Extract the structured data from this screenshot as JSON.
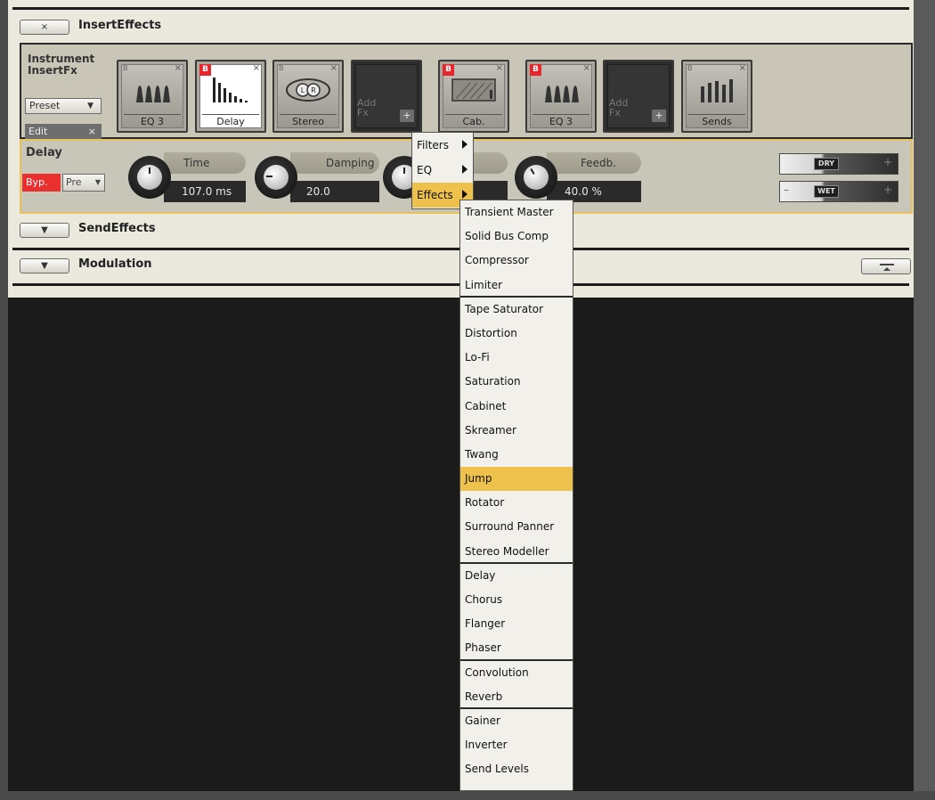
{
  "insert_effects": {
    "close_label": "×",
    "title": "InsertEffects",
    "fx_label_1": "Instrument",
    "fx_label_2": "InsertFx",
    "preset_label": "Preset",
    "edit_label": "Edit",
    "slots": [
      {
        "name": "EQ 3",
        "bypass_badge": ""
      },
      {
        "name": "Delay",
        "bypass_badge": "B"
      },
      {
        "name": "Stereo",
        "bypass_badge": ""
      },
      {
        "name": "",
        "add_line1": "Add",
        "add_line2": "Fx",
        "plus": "+"
      },
      {
        "name": "Cab.",
        "bypass_badge": "B"
      },
      {
        "name": "EQ 3",
        "bypass_badge": "B"
      },
      {
        "name": "",
        "add_line1": "Add",
        "add_line2": "Fx",
        "plus": "+"
      },
      {
        "name": "Sends",
        "bypass_badge": ""
      }
    ]
  },
  "delay_panel": {
    "title": "Delay",
    "bypass_label": "Byp.",
    "pre_label": "Pre",
    "params": [
      {
        "label": "Time",
        "value": "107.0  ms"
      },
      {
        "label": "Damping",
        "value": "20.0"
      },
      {
        "label": "",
        "value": ""
      },
      {
        "label": "Feedb.",
        "value": "40.0  %"
      }
    ],
    "dry_label": "DRY",
    "wet_label": "WET",
    "minus": "–",
    "plus": "+"
  },
  "send_effects": {
    "title": "SendEffects",
    "toggle": "▼"
  },
  "modulation": {
    "title": "Modulation",
    "toggle": "▼"
  },
  "context_menu": {
    "items": [
      "Filters",
      "EQ",
      "Effects"
    ],
    "highlighted": "Effects"
  },
  "effects_submenu": {
    "items": [
      "Transient Master",
      "Solid Bus Comp",
      "Compressor",
      "Limiter",
      "Tape Saturator",
      "Distortion",
      "Lo-Fi",
      "Saturation",
      "Cabinet",
      "Skreamer",
      "Twang",
      "Jump",
      "Rotator",
      "Surround Panner",
      "Stereo Modeller",
      "Delay",
      "Chorus",
      "Flanger",
      "Phaser",
      "Convolution",
      "Reverb",
      "Gainer",
      "Inverter",
      "Send Levels"
    ],
    "highlighted": "Jump",
    "highlight_color": "#eec04c"
  },
  "colors": {
    "bypass_red": "#ea2f2f",
    "panel_bg": "#ebe9dd",
    "accent_yellow": "#e8c35c"
  }
}
